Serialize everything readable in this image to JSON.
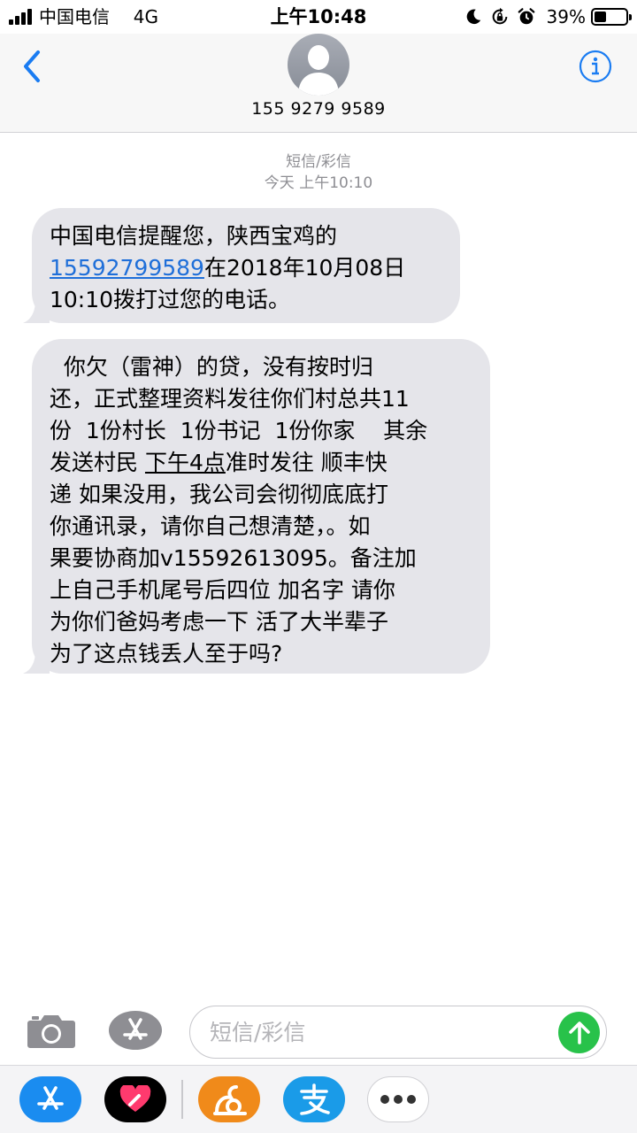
{
  "status_bar": {
    "carrier": "中国电信",
    "network": "4G",
    "time": "上午10:48",
    "battery_percent": "39%",
    "battery_level": 0.39,
    "icons": [
      "moon-icon",
      "rotation-lock-icon",
      "alarm-icon"
    ]
  },
  "header": {
    "contact_number": "155 9279 9589",
    "back_icon": "chevron-left-icon",
    "info_icon": "info-icon",
    "accent_color": "#1a7cf2"
  },
  "conversation": {
    "service_label": "短信/彩信",
    "timestamp": "今天 上午10:10",
    "messages": [
      {
        "text_before": "中国电信提醒您，陕西宝鸡的\n",
        "phone_link": "15592799589",
        "text_after": "在2018年10月08日\n10:10拨打过您的电话。"
      },
      {
        "text_1": "  你欠（雷神）的贷，没有按时归\n还，正式整理资料发往你们村总共11\n份  1份村长  1份书记  1份你家    其余\n发送村民 ",
        "underlined": "下午4点",
        "text_2": "准时发往 顺丰快\n递 如果没用，我公司会彻彻底底打\n你通讯录，请你自己想清楚，。如\n果要协商加v15592613095。备注加\n上自己手机尾号后四位 加名字 请你\n为你们爸妈考虑一下 活了大半辈子\n为了这点钱丢人至于吗?"
      }
    ]
  },
  "input_bar": {
    "placeholder": "短信/彩信",
    "camera_icon": "camera-icon",
    "apps_icon": "app-store-icon",
    "send_icon": "arrow-up-icon",
    "send_color": "#28c24a"
  },
  "app_drawer": {
    "apps": [
      {
        "icon": "app-store-icon",
        "color": "#1a8cf0"
      },
      {
        "icon": "digital-touch-heart-icon",
        "color": "#000000"
      },
      {
        "icon": "uc-browser-icon",
        "color": "#f08a1a"
      },
      {
        "icon": "alipay-icon",
        "color": "#1a9be8"
      },
      {
        "icon": "more-icon",
        "color": "#ffffff"
      }
    ]
  }
}
